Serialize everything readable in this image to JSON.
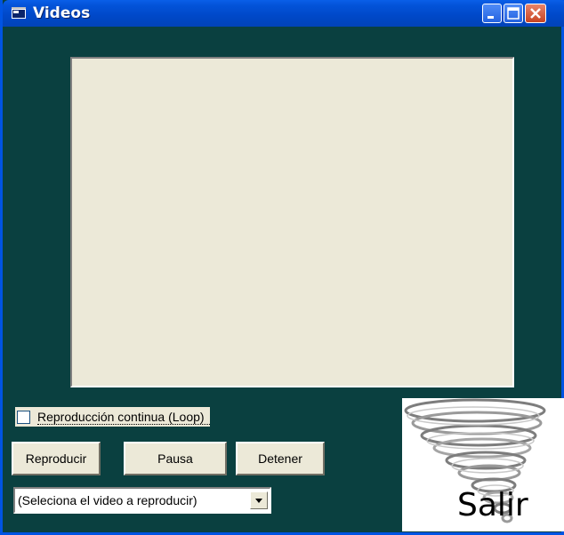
{
  "window": {
    "title": "Videos",
    "title_icon": "window-app-icon",
    "controls": {
      "minimize_icon": "minimize-icon",
      "maximize_icon": "maximize-icon",
      "close_icon": "close-icon"
    }
  },
  "colors": {
    "titlebar": "#0048c8",
    "form_background": "#0a4040",
    "control_face": "#ece9d8",
    "close_button": "#c84422"
  },
  "player": {
    "loop_label": "Reproducción continua (Loop)",
    "loop_checked": false,
    "buttons": {
      "play": "Reproducir",
      "pause": "Pausa",
      "stop": "Detener"
    },
    "video_select": {
      "selected": "(Seleciona el video a reproducir)"
    }
  },
  "exit": {
    "label": "Salir",
    "image": "tornado-swirl-image"
  }
}
